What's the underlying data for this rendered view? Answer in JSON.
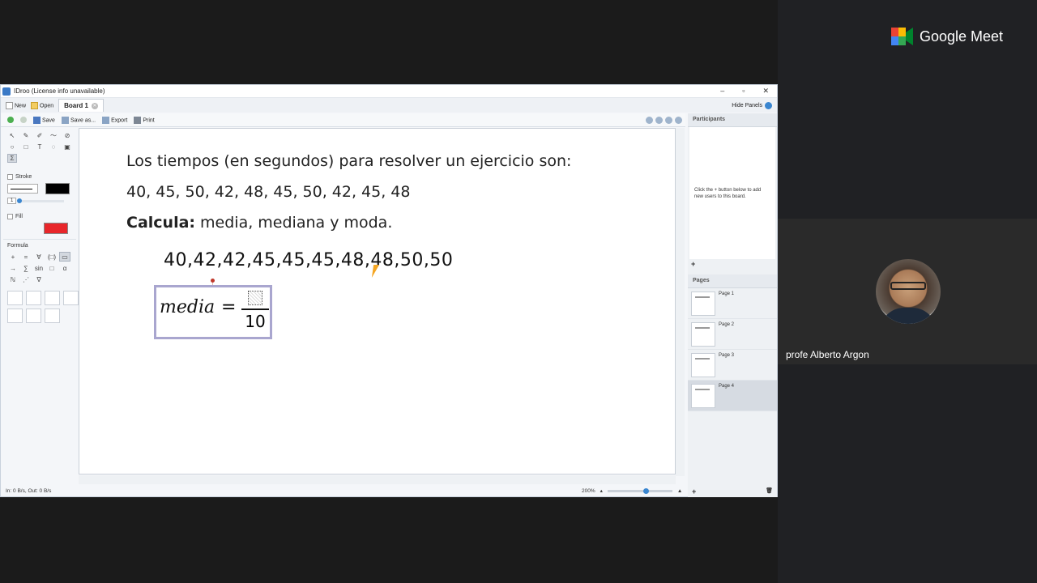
{
  "meet": {
    "brand": "Google Meet",
    "participant_name": "profe Alberto Argon"
  },
  "window": {
    "title": "IDroo (License info unavailable)",
    "controls": [
      "–",
      "▫",
      "✕"
    ]
  },
  "tabs": {
    "new_label": "New",
    "open_label": "Open",
    "board_label": "Board 1",
    "hide_panels_label": "Hide Panels"
  },
  "toolbar": {
    "save_label": "Save",
    "save_as_label": "Save as...",
    "export_label": "Export",
    "print_label": "Print"
  },
  "tools": {
    "stroke_label": "Stroke",
    "stroke_width": "1",
    "fill_label": "Fill",
    "formula_label": "Formula",
    "stroke_color": "#000000",
    "fill_color": "#e8262a"
  },
  "board": {
    "line1": "Los tiempos (en segundos) para resolver un ejercicio son:",
    "line2": "40, 45, 50, 42, 48, 45, 50, 42, 45, 48",
    "line3_bold": "Calcula:",
    "line3_rest": " media, mediana y moda.",
    "sorted": "40,42,42,45,45,45,48,48,50,50",
    "formula_var": "media",
    "formula_eq": "=",
    "formula_den": "10"
  },
  "participants_panel": {
    "title": "Participants",
    "hint": "Click the + button below to add new users to this board.",
    "add": "+"
  },
  "pages_panel": {
    "title": "Pages",
    "pages": [
      "Page 1",
      "Page 2",
      "Page 3",
      "Page 4"
    ],
    "add": "+",
    "delete": "🗑"
  },
  "status": {
    "network": "In: 0 B/s, Out: 0 B/s",
    "zoom": "200%"
  }
}
